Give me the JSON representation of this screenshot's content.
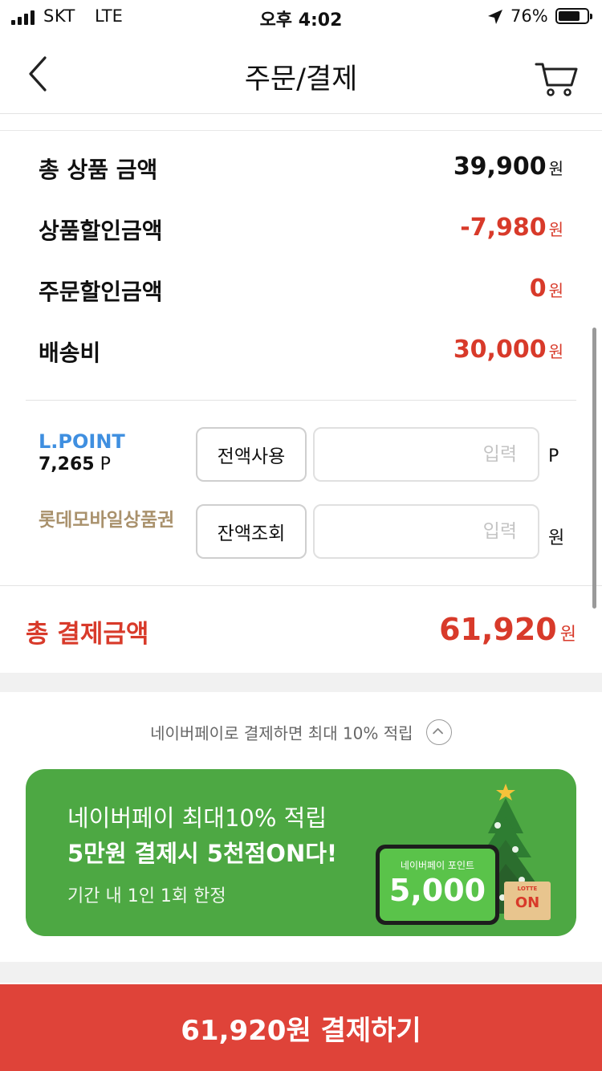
{
  "status_bar": {
    "carrier": "SKT",
    "network": "LTE",
    "time": "오후 4:02",
    "battery_pct": "76%",
    "battery_level": 0.76
  },
  "header": {
    "title": "주문/결제",
    "back_icon": "chevron-left-icon",
    "cart_icon": "cart-icon"
  },
  "summary": {
    "rows": [
      {
        "label": "총 상품 금액",
        "value": "39,900",
        "unit": "원"
      },
      {
        "label": "상품할인금액",
        "value": "-7,980",
        "unit": "원"
      },
      {
        "label": "주문할인금액",
        "value": "0",
        "unit": "원"
      },
      {
        "label": "배송비",
        "value": "30,000",
        "unit": "원"
      }
    ]
  },
  "points": {
    "lpoint_title": "L.POINT",
    "lpoint_balance": "7,265",
    "lpoint_balance_unit": "P",
    "lpoint_button": "전액사용",
    "lpoint_placeholder": "입력",
    "lpoint_unit": "P",
    "voucher_title": "롯데모바일상품권",
    "voucher_button": "잔액조회",
    "voucher_placeholder": "입력",
    "voucher_unit": "원"
  },
  "total": {
    "label": "총 결제금액",
    "value": "61,920",
    "unit": "원"
  },
  "naver_note": "네이버페이로 결제하면 최대 10% 적립",
  "banner": {
    "line1": "네이버페이 최대10% 적립",
    "line2": "5만원 결제시 5천점ON다!",
    "line3": "기간 내 1인 1회 한정",
    "card_label": "네이버페이 포인트",
    "card_value": "5,000",
    "box_logo": "LOTTE",
    "box_on": "ON"
  },
  "pay_button": "61,920원 결제하기",
  "colors": {
    "accent_red": "#d83a2a",
    "pay_button": "#df4339",
    "lpoint_blue": "#3f8fe0",
    "voucher_tan": "#a9916c",
    "banner_green": "#4da843"
  }
}
